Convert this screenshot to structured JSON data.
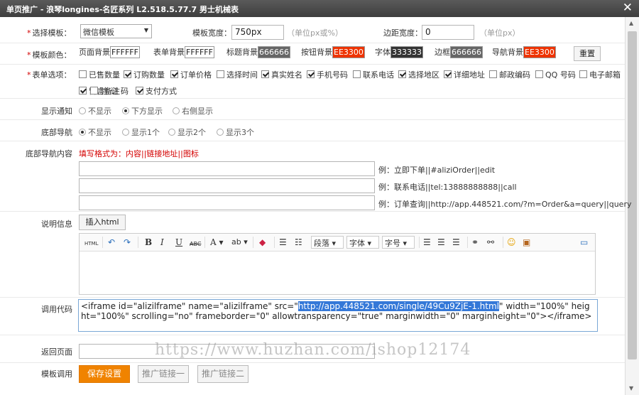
{
  "window": {
    "title": "单页推广 - 浪琴longines-名匠系列 L2.518.5.77.7 男士机械表",
    "close_glyph": "✕"
  },
  "template_row": {
    "label": "选择模板：",
    "select_value": "微信模板",
    "width_label": "模板宽度：",
    "width_value": "750px",
    "width_hint": "（单位px或%）",
    "margin_label": "边距宽度：",
    "margin_value": "0",
    "margin_hint": "（单位px）"
  },
  "color_row": {
    "label": "模板颜色：",
    "items": [
      {
        "label": "页面背景",
        "value": "FFFFFF",
        "bg": "#ffffff",
        "fg": "#222222"
      },
      {
        "label": "表单背景",
        "value": "FFFFFF",
        "bg": "#ffffff",
        "fg": "#222222"
      },
      {
        "label": "标题背景",
        "value": "666666",
        "bg": "#666666",
        "fg": "#ffffff"
      },
      {
        "label": "按钮背景",
        "value": "EE3300",
        "bg": "#ee3300",
        "fg": "#ffffff"
      },
      {
        "label": "字体",
        "value": "333333",
        "bg": "#333333",
        "fg": "#ffffff"
      },
      {
        "label": "边框",
        "value": "666666",
        "bg": "#666666",
        "fg": "#ffffff"
      },
      {
        "label": "导航背景",
        "value": "EE3300",
        "bg": "#ee3300",
        "fg": "#ffffff"
      }
    ],
    "reset_label": "重置"
  },
  "form_options": {
    "label": "表单选项：",
    "items": [
      {
        "label": "已售数量",
        "checked": false
      },
      {
        "label": "订购数量",
        "checked": true
      },
      {
        "label": "订单价格",
        "checked": true
      },
      {
        "label": "选择时间",
        "checked": false
      },
      {
        "label": "真实姓名",
        "checked": true
      },
      {
        "label": "手机号码",
        "checked": true
      },
      {
        "label": "联系电话",
        "checked": false
      },
      {
        "label": "选择地区",
        "checked": true
      },
      {
        "label": "详细地址",
        "checked": true
      },
      {
        "label": "邮政编码",
        "checked": false
      },
      {
        "label": "QQ 号码",
        "checked": false
      },
      {
        "label": "电子邮箱",
        "checked": false
      },
      {
        "label": "留言备注",
        "checked": true
      },
      {
        "label": "验 证 码",
        "checked": false
      },
      {
        "label": "支付方式",
        "checked": true
      }
    ]
  },
  "notify_row": {
    "label": "显示通知",
    "options": [
      {
        "label": "不显示",
        "selected": false
      },
      {
        "label": "下方显示",
        "selected": true
      },
      {
        "label": "右侧显示",
        "selected": false
      }
    ]
  },
  "bottom_nav_row": {
    "label": "底部导航",
    "options": [
      {
        "label": "不显示",
        "selected": true
      },
      {
        "label": "显示1个",
        "selected": false
      },
      {
        "label": "显示2个",
        "selected": false
      },
      {
        "label": "显示3个",
        "selected": false
      }
    ]
  },
  "nav_content": {
    "label": "底部导航内容",
    "format_hint": "填写格式为：内容||链接地址||图标",
    "examples": [
      "例：立即下单||#aliziOrder||edit",
      "例：联系电话||tel:13888888888||call",
      "例：订单查询||http://app.448521.com/?m=Order&a=query||query"
    ]
  },
  "description": {
    "label": "说明信息",
    "insert_html_label": "插入html",
    "toolbar": {
      "html": "HTML",
      "paragraph": "段落",
      "font": "字体",
      "size": "字号"
    }
  },
  "embed_code": {
    "label": "调用代码",
    "before": "<iframe id=\"alizilframe\" name=\"alizilframe\" src=\"",
    "url": "http://app.448521.com/single/49Cu9ZjE-1.html",
    "after": "\" width=\"100%\" height=\"100%\" scrolling=\"no\" frameborder=\"0\" allowtransparency=\"true\" marginwidth=\"0\" marginheight=\"0\"></iframe>"
  },
  "return_row": {
    "label": "返回页面"
  },
  "template_call": {
    "label": "模板调用",
    "save_label": "保存设置",
    "link1_label": "推广链接一",
    "link2_label": "推广链接二"
  },
  "watermark": "https://www.huzhan.com/ishop12174",
  "colors": {
    "accent": "#f08300",
    "required": "#d40000",
    "hint_red": "#d40000"
  }
}
